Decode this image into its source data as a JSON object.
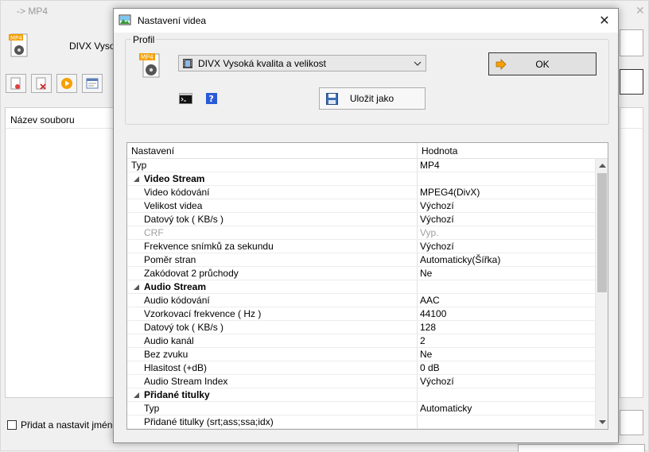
{
  "background": {
    "title": "-> MP4",
    "close_glyph": "✕",
    "profile_label": "DIVX Vysoká kvalita a velikost",
    "list_header": "Název souboru",
    "checkbox_label": "Přidat a nastavit jméno [DIVX Vysoká kvalita a velikost]"
  },
  "dialog": {
    "title": "Nastavení videa",
    "close_glyph": "✕",
    "group_label": "Profil",
    "profile_value": "DIVX Vysoká kvalita a velikost",
    "ok_label": "OK",
    "save_label": "Uložit jako"
  },
  "grid": {
    "header_setting": "Nastavení",
    "header_value": "Hodnota",
    "rows": [
      {
        "label": "Typ",
        "value": "MP4"
      },
      {
        "label": "Video Stream",
        "value": ""
      },
      {
        "label": "Video kódování",
        "value": "MPEG4(DivX)"
      },
      {
        "label": "Velikost videa",
        "value": "Výchozí"
      },
      {
        "label": "Datový tok ( KB/s )",
        "value": "Výchozí"
      },
      {
        "label": "CRF",
        "value": "Vyp."
      },
      {
        "label": "Frekvence snímků za sekundu",
        "value": "Výchozí"
      },
      {
        "label": "Poměr stran",
        "value": "Automaticky(Šířka)"
      },
      {
        "label": "Zakódovat 2 průchody",
        "value": "Ne"
      },
      {
        "label": "Audio Stream",
        "value": ""
      },
      {
        "label": "Audio kódování",
        "value": "AAC"
      },
      {
        "label": "Vzorkovací frekvence ( Hz )",
        "value": "44100"
      },
      {
        "label": "Datový tok ( KB/s )",
        "value": "128"
      },
      {
        "label": "Audio kanál",
        "value": "2"
      },
      {
        "label": "Bez zvuku",
        "value": "Ne"
      },
      {
        "label": "Hlasitost (+dB)",
        "value": "0 dB"
      },
      {
        "label": "Audio Stream Index",
        "value": "Výchozí"
      },
      {
        "label": "Přidané titulky",
        "value": ""
      },
      {
        "label": "Typ",
        "value": "Automaticky"
      },
      {
        "label": "Přidané titulky (srt;ass;ssa;idx)",
        "value": ""
      }
    ]
  },
  "colors": {
    "accent_orange": "#f5a000",
    "help_blue": "#2a5bd7"
  }
}
